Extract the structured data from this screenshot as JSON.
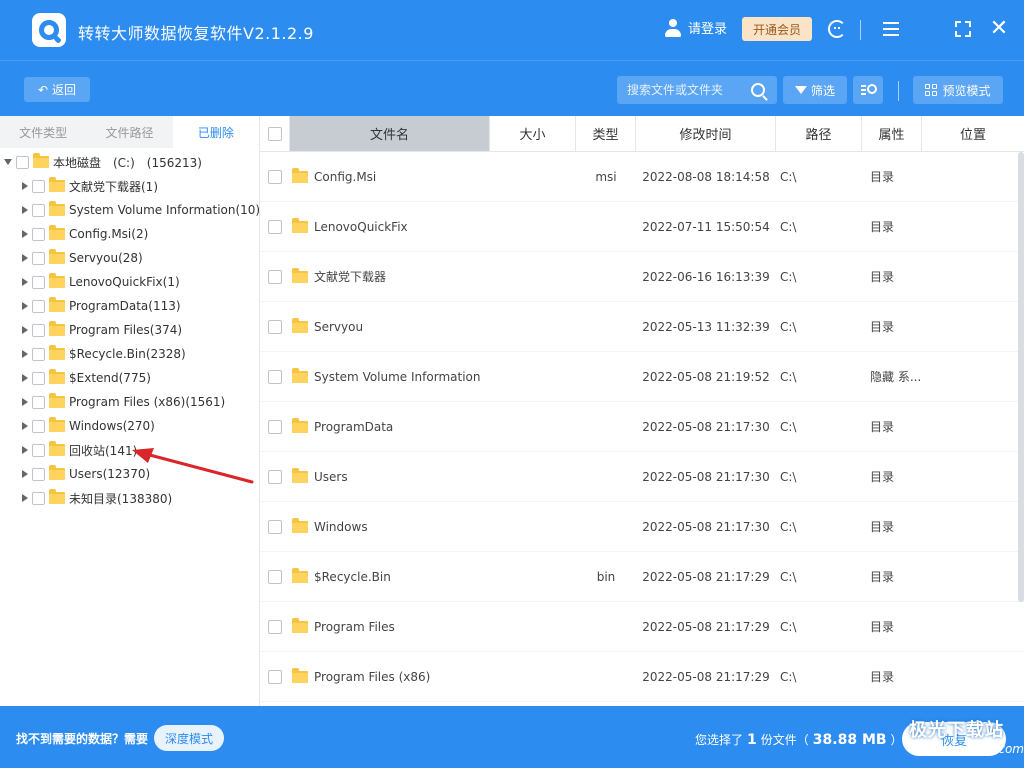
{
  "app": {
    "title": "转转大师数据恢复软件V2.1.2.9"
  },
  "titlebar": {
    "login_label": "请登录",
    "vip_label": "开通会员"
  },
  "toolbar": {
    "back_label": "返回",
    "search_placeholder": "搜索文件或文件夹",
    "filter_label": "筛选",
    "preview_label": "预览模式"
  },
  "left_tabs": [
    {
      "label": "文件类型",
      "active": false
    },
    {
      "label": "文件路径",
      "active": false
    },
    {
      "label": "已删除",
      "active": true
    }
  ],
  "tree": {
    "root": {
      "label": "本地磁盘　(C:)　(156213)"
    },
    "children": [
      {
        "label": "文献党下载器(1)"
      },
      {
        "label": "System Volume Information(10)"
      },
      {
        "label": "Config.Msi(2)"
      },
      {
        "label": "Servyou(28)"
      },
      {
        "label": "LenovoQuickFix(1)"
      },
      {
        "label": "ProgramData(113)"
      },
      {
        "label": "Program Files(374)"
      },
      {
        "label": "$Recycle.Bin(2328)"
      },
      {
        "label": "$Extend(775)"
      },
      {
        "label": "Program Files (x86)(1561)"
      },
      {
        "label": "Windows(270)"
      },
      {
        "label": "回收站(141)"
      },
      {
        "label": "Users(12370)"
      },
      {
        "label": "未知目录(138380)"
      }
    ]
  },
  "table": {
    "headers": {
      "name": "文件名",
      "size": "大小",
      "type": "类型",
      "time": "修改时间",
      "path": "路径",
      "attr": "属性",
      "loc": "位置"
    },
    "rows": [
      {
        "name": "Config.Msi",
        "size": "",
        "type": "msi",
        "time": "2022-08-08 18:14:58",
        "path": "C:\\",
        "attr": "目录",
        "loc": ""
      },
      {
        "name": "LenovoQuickFix",
        "size": "",
        "type": "",
        "time": "2022-07-11 15:50:54",
        "path": "C:\\",
        "attr": "目录",
        "loc": ""
      },
      {
        "name": "文献党下载器",
        "size": "",
        "type": "",
        "time": "2022-06-16 16:13:39",
        "path": "C:\\",
        "attr": "目录",
        "loc": ""
      },
      {
        "name": "Servyou",
        "size": "",
        "type": "",
        "time": "2022-05-13 11:32:39",
        "path": "C:\\",
        "attr": "目录",
        "loc": ""
      },
      {
        "name": "System Volume Information",
        "size": "",
        "type": "",
        "time": "2022-05-08 21:19:52",
        "path": "C:\\",
        "attr": "隐藏 系...",
        "loc": ""
      },
      {
        "name": "ProgramData",
        "size": "",
        "type": "",
        "time": "2022-05-08 21:17:30",
        "path": "C:\\",
        "attr": "目录",
        "loc": ""
      },
      {
        "name": "Users",
        "size": "",
        "type": "",
        "time": "2022-05-08 21:17:30",
        "path": "C:\\",
        "attr": "目录",
        "loc": ""
      },
      {
        "name": "Windows",
        "size": "",
        "type": "",
        "time": "2022-05-08 21:17:30",
        "path": "C:\\",
        "attr": "目录",
        "loc": ""
      },
      {
        "name": "$Recycle.Bin",
        "size": "",
        "type": "bin",
        "time": "2022-05-08 21:17:29",
        "path": "C:\\",
        "attr": "目录",
        "loc": ""
      },
      {
        "name": "Program Files",
        "size": "",
        "type": "",
        "time": "2022-05-08 21:17:29",
        "path": "C:\\",
        "attr": "目录",
        "loc": ""
      },
      {
        "name": "Program Files (x86)",
        "size": "",
        "type": "",
        "time": "2022-05-08 21:17:29",
        "path": "C:\\",
        "attr": "目录",
        "loc": ""
      }
    ]
  },
  "bottom": {
    "hint_text": "找不到需要的数据？需要",
    "deep_mode_label": "深度模式",
    "selected_prefix": "您选择了",
    "selected_count": "1",
    "selected_unit": "份文件（",
    "selected_size": "38.88 MB",
    "selected_suffix": "）",
    "recover_label": "恢复"
  },
  "watermark": {
    "main": "极光下载站",
    "sub": "www.xz7.com"
  },
  "colors": {
    "primary": "#2d8cf0",
    "arrow": "#d9262b",
    "folder": "#f6c342"
  }
}
